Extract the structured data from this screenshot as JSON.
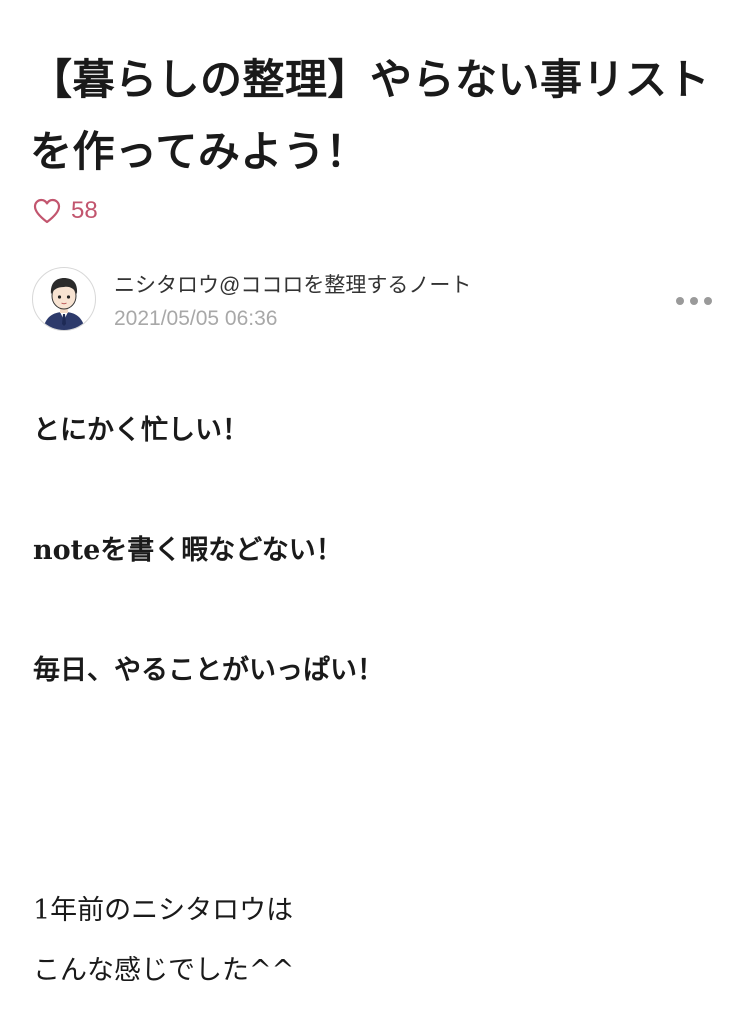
{
  "article": {
    "title": "【暮らしの整理】やらない事リストを作ってみよう！",
    "like_count": "58"
  },
  "author": {
    "name": "ニシタロウ@ココロを整理するノート",
    "date": "2021/05/05 06:36"
  },
  "content": {
    "paragraphs": [
      "とにかく忙しい！",
      "noteを書く暇などない！",
      "毎日、やることがいっぱい！",
      "1年前のニシタロウは",
      "こんな感じでした^^"
    ]
  },
  "colors": {
    "like_accent": "#c2556e",
    "date_gray": "#a8a8a8",
    "text_dark": "#1a1a1a"
  },
  "icons": {
    "like": "heart-outline-icon",
    "more": "ellipsis-horizontal-icon"
  }
}
